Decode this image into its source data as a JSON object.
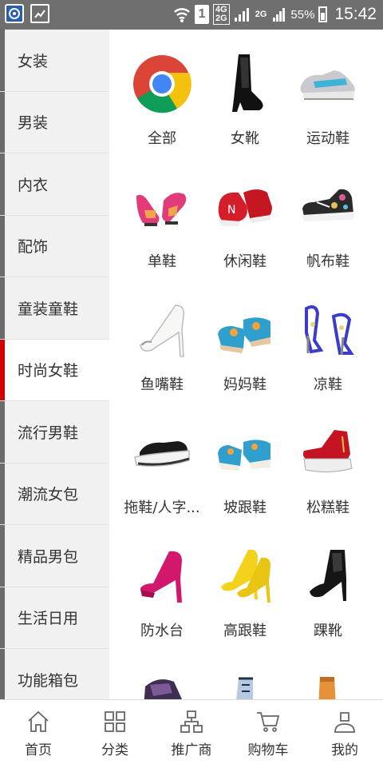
{
  "status_bar": {
    "sim": "1",
    "net_top": "4G",
    "net_bottom": "2G",
    "net2": "2G",
    "battery": "55%",
    "time": "15:42"
  },
  "sidebar": {
    "items": [
      {
        "label": "女装"
      },
      {
        "label": "男装"
      },
      {
        "label": "内衣"
      },
      {
        "label": "配饰"
      },
      {
        "label": "童装童鞋"
      },
      {
        "label": "时尚女鞋"
      },
      {
        "label": "流行男鞋"
      },
      {
        "label": "潮流女包"
      },
      {
        "label": "精品男包"
      },
      {
        "label": "生活日用"
      },
      {
        "label": "功能箱包"
      }
    ],
    "active_index": 5
  },
  "grid": {
    "items": [
      {
        "label": "全部",
        "icon": "chrome-icon"
      },
      {
        "label": "女靴",
        "icon": "boot-icon"
      },
      {
        "label": "运动鞋",
        "icon": "sneaker-icon"
      },
      {
        "label": "单鞋",
        "icon": "flat-shoe-icon"
      },
      {
        "label": "休闲鞋",
        "icon": "casual-shoe-icon"
      },
      {
        "label": "帆布鞋",
        "icon": "canvas-shoe-icon"
      },
      {
        "label": "鱼嘴鞋",
        "icon": "peep-toe-icon"
      },
      {
        "label": "妈妈鞋",
        "icon": "mom-shoe-icon"
      },
      {
        "label": "凉鞋",
        "icon": "sandal-icon"
      },
      {
        "label": "拖鞋/人字...",
        "icon": "slipper-icon"
      },
      {
        "label": "坡跟鞋",
        "icon": "wedge-icon"
      },
      {
        "label": "松糕鞋",
        "icon": "platform-icon"
      },
      {
        "label": "防水台",
        "icon": "platform-heel-icon"
      },
      {
        "label": "高跟鞋",
        "icon": "high-heel-icon"
      },
      {
        "label": "踝靴",
        "icon": "ankle-boot-icon"
      },
      {
        "label": "",
        "icon": "sneaker-icon"
      },
      {
        "label": "",
        "icon": "boot-icon"
      },
      {
        "label": "",
        "icon": "boot-icon"
      }
    ]
  },
  "bottom_nav": {
    "items": [
      {
        "label": "首页",
        "icon": "home-icon"
      },
      {
        "label": "分类",
        "icon": "grid-icon"
      },
      {
        "label": "推广商",
        "icon": "org-chart-icon"
      },
      {
        "label": "购物车",
        "icon": "cart-icon"
      },
      {
        "label": "我的",
        "icon": "user-icon"
      }
    ]
  },
  "colors": {
    "active_indicator": "#d00000",
    "sidebar_bar": "#6b6b6b",
    "status_bar": "#6f6f6f"
  }
}
